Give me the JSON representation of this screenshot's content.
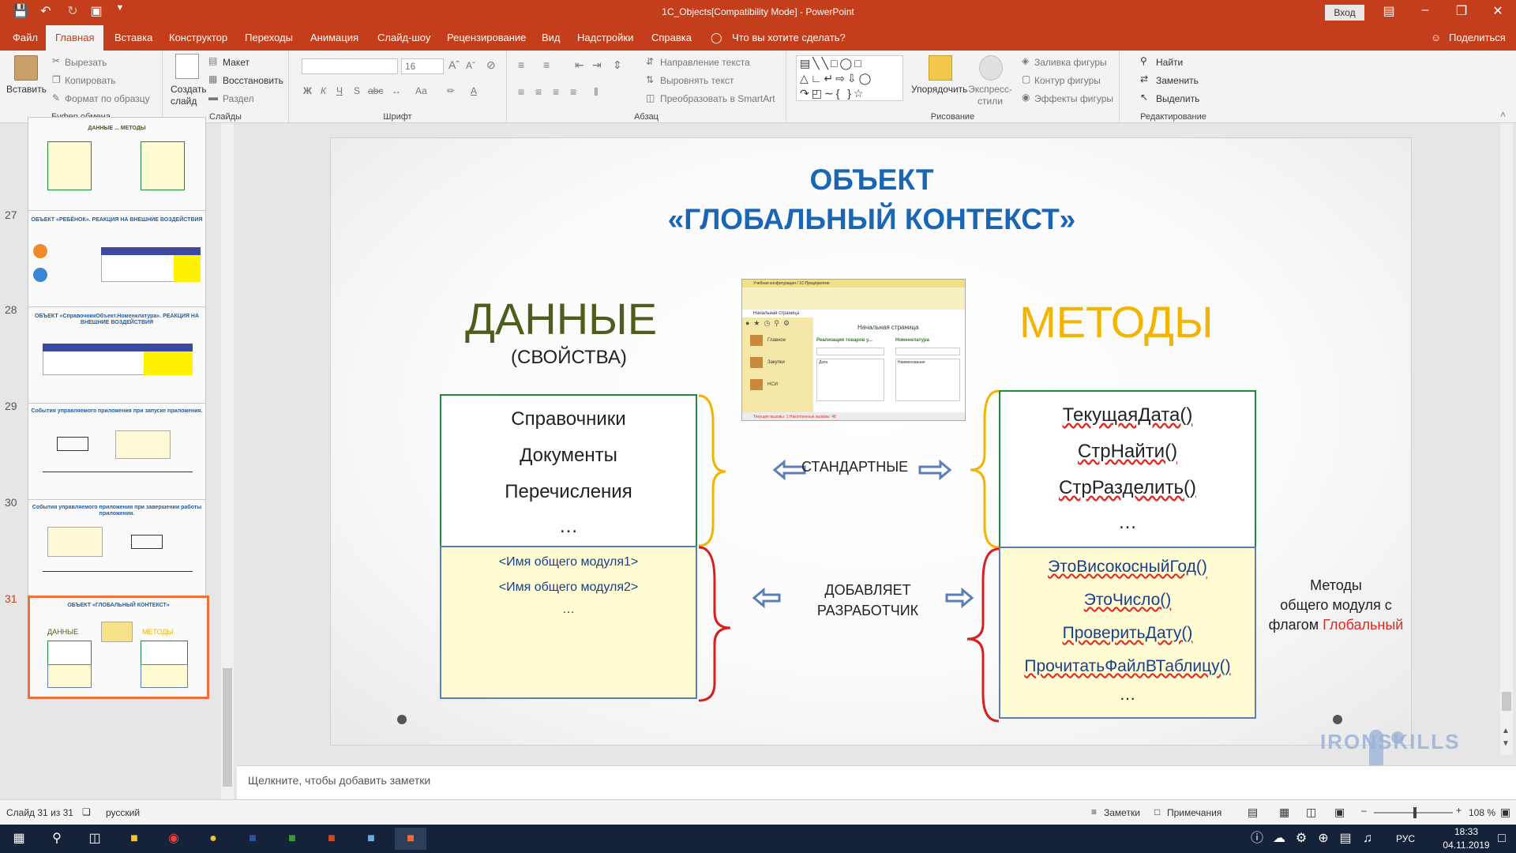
{
  "window": {
    "title": "1C_Objects[Compatibility Mode]  -  PowerPoint",
    "signin": "Вход"
  },
  "tabs": [
    "Файл",
    "Главная",
    "Вставка",
    "Конструктор",
    "Переходы",
    "Анимация",
    "Слайд-шоу",
    "Рецензирование",
    "Вид",
    "Надстройки",
    "Справка"
  ],
  "tell_me": "Что вы хотите сделать?",
  "share": "Поделиться",
  "ribbon": {
    "clipboard": {
      "paste": "Вставить",
      "cut": "Вырезать",
      "copy": "Копировать",
      "format": "Формат по образцу",
      "label": "Буфер обмена"
    },
    "slides": {
      "new_slide": "Создать слайд",
      "layout": "Макет",
      "reset": "Восстановить",
      "section": "Раздел",
      "label": "Слайды"
    },
    "font": {
      "size": "16",
      "label": "Шрифт"
    },
    "paragraph": {
      "text_dir": "Направление текста",
      "align_text": "Выровнять текст",
      "smartart": "Преобразовать в SmartArt",
      "label": "Абзац"
    },
    "drawing": {
      "arrange": "Упорядочить",
      "quick_styles": "Экспресс-стили",
      "fill": "Заливка фигуры",
      "outline": "Контур фигуры",
      "effects": "Эффекты фигуры",
      "label": "Рисование"
    },
    "editing": {
      "find": "Найти",
      "replace": "Заменить",
      "select": "Выделить",
      "label": "Редактирование"
    }
  },
  "thumbnails": [
    {
      "num": "",
      "title": "ДАННЫЕ ... МЕТОДЫ"
    },
    {
      "num": "27",
      "title": "ОБЪЕКТ «РЕБЁНОК». РЕАКЦИЯ НА ВНЕШНИЕ ВОЗДЕЙСТВИЯ"
    },
    {
      "num": "28",
      "title": "ОБЪЕКТ «СправочникОбъект.Номенклатура». РЕАКЦИЯ НА ВНЕШНИЕ ВОЗДЕЙСТВИЯ"
    },
    {
      "num": "29",
      "title": "События управляемого приложения при запуске приложения."
    },
    {
      "num": "30",
      "title": "События управляемого приложения при завершении работы приложения."
    },
    {
      "num": "31",
      "title": "ОБЪЕКТ «ГЛОБАЛЬНЫЙ КОНТЕКСТ»"
    }
  ],
  "slide": {
    "title1": "ОБЪЕКТ",
    "title2": "«ГЛОБАЛЬНЫЙ КОНТЕКСТ»",
    "data_heading": "ДАННЫЕ",
    "data_sub": "(СВОЙСТВА)",
    "methods_heading": "МЕТОДЫ",
    "data_std": [
      "Справочники",
      "Документы",
      "Перечисления",
      "…"
    ],
    "data_custom": [
      "<Имя общего модуля1>",
      "<Имя общего модуля2>",
      "…"
    ],
    "methods_std": [
      "ТекущаяДата()",
      "СтрНайти()",
      "СтрРазделить()",
      "…"
    ],
    "methods_custom": [
      "ЭтоВисокосныйГод()",
      "ЭтоЧисло()",
      "ПроверитьДату()",
      "ПрочитатьФайлВТаблицу()",
      "…"
    ],
    "standard_label": "СТАНДАРТНЫЕ",
    "dev_label1": "ДОБАВЛЯЕТ",
    "dev_label2": "РАЗРАБОТЧИК",
    "note1": "Методы",
    "note2": "общего модуля с",
    "note3": "флагом ",
    "note_flag": "Глобальный",
    "screenshot": {
      "window_title": "Учебная конфигурация / 1С:Предприятие",
      "tab": "Начальная страница",
      "heading": "Начальная страница",
      "col1": "Реализация товаров у...",
      "col2": "Номенклатура",
      "nav": [
        "Главное",
        "Закупки",
        "НСИ"
      ],
      "field1": "Дата",
      "field2": "Наименование",
      "status": "Текущие вызовы: 1  Накопленные вызовы: 48"
    }
  },
  "notes_placeholder": "Щелкните, чтобы добавить заметки",
  "status": {
    "slide": "Слайд 31 из 31",
    "lang": "русский",
    "notes": "Заметки",
    "comments": "Примечания",
    "zoom": "108 %"
  },
  "watermark": "IRONSKILLS",
  "taskbar": {
    "lang": "РУС",
    "time": "18:33",
    "date": "04.11.2019"
  },
  "colors": {
    "accent": "#c43e1c",
    "title_blue": "#1a66b5",
    "data_green": "#4b5e1c",
    "methods_gold": "#f2b400",
    "flag_red": "#e0281f"
  }
}
